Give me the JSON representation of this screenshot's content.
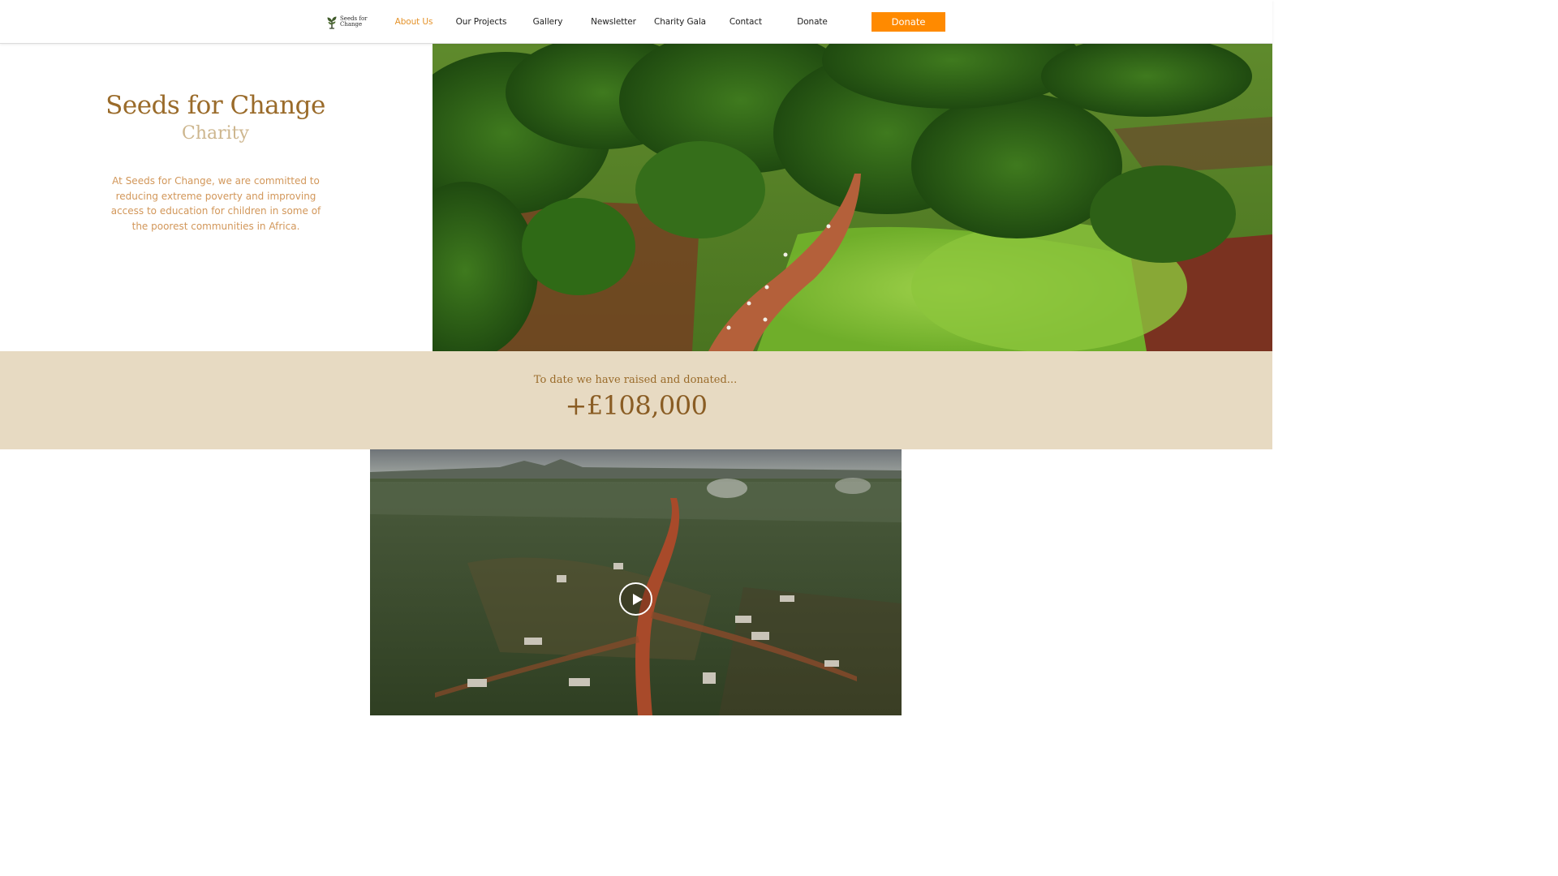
{
  "header": {
    "logo": {
      "line1": "Seeds for",
      "line2": "Change",
      "icon": "sprout-icon"
    },
    "nav": [
      {
        "label": "About Us",
        "active": true
      },
      {
        "label": "Our Projects",
        "active": false
      },
      {
        "label": "Gallery",
        "active": false
      },
      {
        "label": "Newsletter",
        "active": false
      },
      {
        "label": "Charity Gala",
        "active": false
      },
      {
        "label": "Contact",
        "active": false
      },
      {
        "label": "Donate",
        "active": false
      }
    ],
    "donate_button": "Donate"
  },
  "hero": {
    "title": "Seeds for Change",
    "subtitle": "Charity",
    "description": "At Seeds for Change, we are committed to reducing extreme poverty and improving access to education for children in some of the poorest communities in Africa.",
    "image": "aerial-photo-dirt-road-through-green-forest"
  },
  "stats": {
    "label": "To date we have raised and donated...",
    "value": "+£108,000"
  },
  "video": {
    "thumbnail": "aerial-photo-village-with-red-road",
    "control": "play-icon"
  },
  "colors": {
    "accent": "#e5932b",
    "donate_button": "#ff8a00",
    "title_brown": "#9a6b2a",
    "subtitle_tan": "#cdb68e",
    "body_text": "#d2975a",
    "band_background": "#e7dac2"
  }
}
